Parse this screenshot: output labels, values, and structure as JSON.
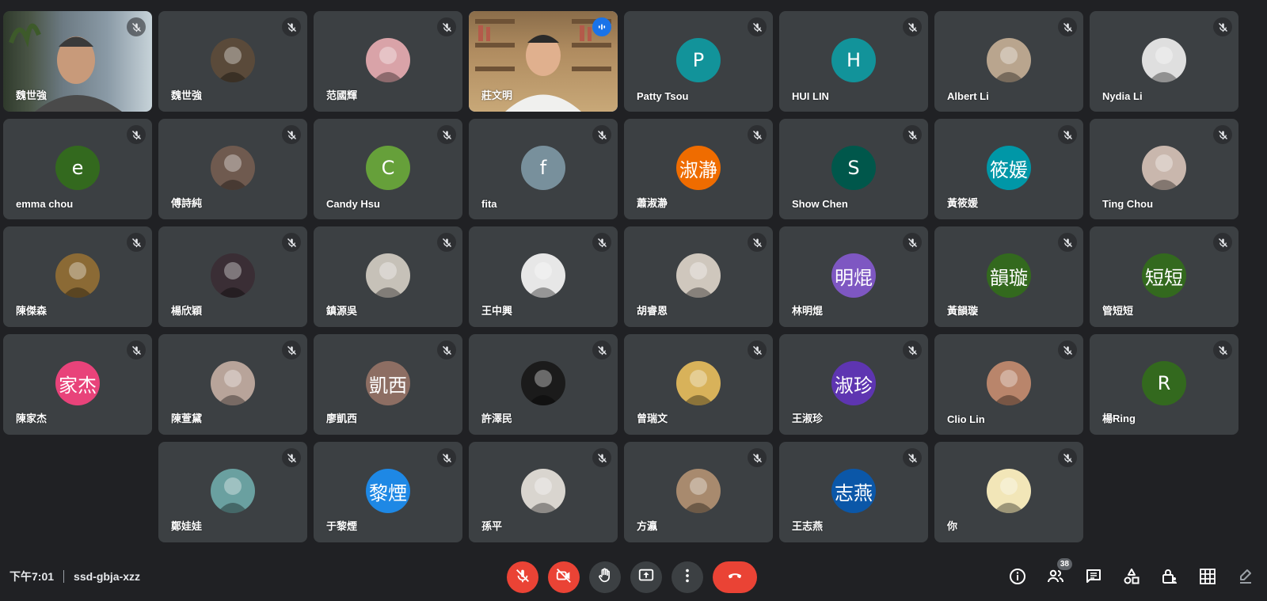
{
  "colors": {
    "background": "#202124",
    "tile": "#3c4043",
    "accent_speaking": "#8ab4f8",
    "danger": "#ea4335"
  },
  "participants": [
    {
      "name": "魏世強",
      "kind": "video",
      "muted": true
    },
    {
      "name": "魏世強",
      "kind": "photo",
      "avatar_color": "#5a4a3a",
      "muted": true
    },
    {
      "name": "范國輝",
      "kind": "photo",
      "avatar_color": "#d9a3a8",
      "muted": true
    },
    {
      "name": "莊文明",
      "kind": "video",
      "muted": false,
      "speaking": true
    },
    {
      "name": "Patty Tsou",
      "kind": "initial",
      "initial": "P",
      "avatar_color": "#12939a",
      "muted": true
    },
    {
      "name": "HUI LIN",
      "kind": "initial",
      "initial": "H",
      "avatar_color": "#12939a",
      "muted": true
    },
    {
      "name": "Albert Li",
      "kind": "photo",
      "avatar_color": "#b9a58e",
      "muted": true
    },
    {
      "name": "Nydia Li",
      "kind": "photo",
      "avatar_color": "#dfdfdf",
      "muted": true
    },
    {
      "name": "emma chou",
      "kind": "initial",
      "initial": "e",
      "avatar_color": "#33691e",
      "muted": true
    },
    {
      "name": "傅詩純",
      "kind": "photo",
      "avatar_color": "#6f5a4f",
      "muted": true
    },
    {
      "name": "Candy Hsu",
      "kind": "initial",
      "initial": "C",
      "avatar_color": "#66a03a",
      "muted": true
    },
    {
      "name": "fita",
      "kind": "initial",
      "initial": "f",
      "avatar_color": "#78909c",
      "muted": true
    },
    {
      "name": "蕭淑瀞",
      "kind": "initial",
      "initial": "淑瀞",
      "avatar_color": "#ef6c00",
      "muted": true
    },
    {
      "name": "Show Chen",
      "kind": "initial",
      "initial": "S",
      "avatar_color": "#00574b",
      "muted": true
    },
    {
      "name": "黃筱媛",
      "kind": "initial",
      "initial": "筱媛",
      "avatar_color": "#0097a7",
      "muted": true
    },
    {
      "name": "Ting Chou",
      "kind": "photo",
      "avatar_color": "#c9b7ad",
      "muted": true
    },
    {
      "name": "陳傑森",
      "kind": "photo",
      "avatar_color": "#8b6a35",
      "muted": true
    },
    {
      "name": "楊欣穎",
      "kind": "photo",
      "avatar_color": "#3a2e35",
      "muted": true
    },
    {
      "name": "鎮源吳",
      "kind": "photo",
      "avatar_color": "#c6c1b8",
      "muted": true
    },
    {
      "name": "王中興",
      "kind": "photo",
      "avatar_color": "#e7e7e7",
      "muted": true
    },
    {
      "name": "胡睿恩",
      "kind": "photo",
      "avatar_color": "#cfc7bd",
      "muted": true
    },
    {
      "name": "林明焜",
      "kind": "initial",
      "initial": "明焜",
      "avatar_color": "#7e57c2",
      "muted": true
    },
    {
      "name": "黃韻璇",
      "kind": "initial",
      "initial": "韻璇",
      "avatar_color": "#33691e",
      "muted": true
    },
    {
      "name": "管短短",
      "kind": "initial",
      "initial": "短短",
      "avatar_color": "#33691e",
      "muted": true
    },
    {
      "name": "陳家杰",
      "kind": "initial",
      "initial": "家杰",
      "avatar_color": "#e8437a",
      "muted": true
    },
    {
      "name": "陳萱黛",
      "kind": "photo",
      "avatar_color": "#b8a49a",
      "muted": true
    },
    {
      "name": "廖凱西",
      "kind": "initial",
      "initial": "凱西",
      "avatar_color": "#8d6e63",
      "muted": true
    },
    {
      "name": "許澤民",
      "kind": "photo",
      "avatar_color": "#1b1b1b",
      "muted": true
    },
    {
      "name": "曾瑞文",
      "kind": "photo",
      "avatar_color": "#d8b25a",
      "muted": true
    },
    {
      "name": "王淑珍",
      "kind": "initial",
      "initial": "淑珍",
      "avatar_color": "#5e35b1",
      "muted": true
    },
    {
      "name": "Clio Lin",
      "kind": "photo",
      "avatar_color": "#b9856b",
      "muted": true
    },
    {
      "name": "楊Ring",
      "kind": "initial",
      "initial": "R",
      "avatar_color": "#33691e",
      "muted": true
    },
    {
      "name": "鄭娃娃",
      "kind": "photo",
      "avatar_color": "#6aa0a0",
      "muted": true
    },
    {
      "name": "于黎煙",
      "kind": "initial",
      "initial": "黎煙",
      "avatar_color": "#1e88e5",
      "muted": true
    },
    {
      "name": "孫平",
      "kind": "photo",
      "avatar_color": "#d9d5cf",
      "muted": true
    },
    {
      "name": "方瀛",
      "kind": "photo",
      "avatar_color": "#a88a6e",
      "muted": true
    },
    {
      "name": "王志燕",
      "kind": "initial",
      "initial": "志燕",
      "avatar_color": "#0b57a8",
      "muted": true
    },
    {
      "name": "你",
      "kind": "photo",
      "avatar_color": "#f2e6b8",
      "muted": true
    }
  ],
  "bottom_bar": {
    "time": "下午7:01",
    "meeting_code": "ssd-gbja-xzz",
    "participant_count": "38",
    "controls": [
      {
        "name": "mic-toggle-button",
        "icon": "mic-off-icon",
        "state": "off"
      },
      {
        "name": "camera-toggle-button",
        "icon": "camera-off-icon",
        "state": "off"
      },
      {
        "name": "raise-hand-button",
        "icon": "hand-icon"
      },
      {
        "name": "present-screen-button",
        "icon": "present-icon"
      },
      {
        "name": "more-options-button",
        "icon": "more-vert-icon"
      },
      {
        "name": "leave-call-button",
        "icon": "hangup-icon"
      }
    ],
    "right_icons": [
      {
        "name": "meeting-details-button",
        "icon": "info-icon"
      },
      {
        "name": "people-button",
        "icon": "people-icon"
      },
      {
        "name": "chat-button",
        "icon": "chat-icon"
      },
      {
        "name": "activities-button",
        "icon": "shapes-icon"
      },
      {
        "name": "host-controls-button",
        "icon": "lock-person-icon"
      },
      {
        "name": "grid-view-button",
        "icon": "grid-icon"
      },
      {
        "name": "whiteboard-button",
        "icon": "pen-icon"
      }
    ]
  }
}
